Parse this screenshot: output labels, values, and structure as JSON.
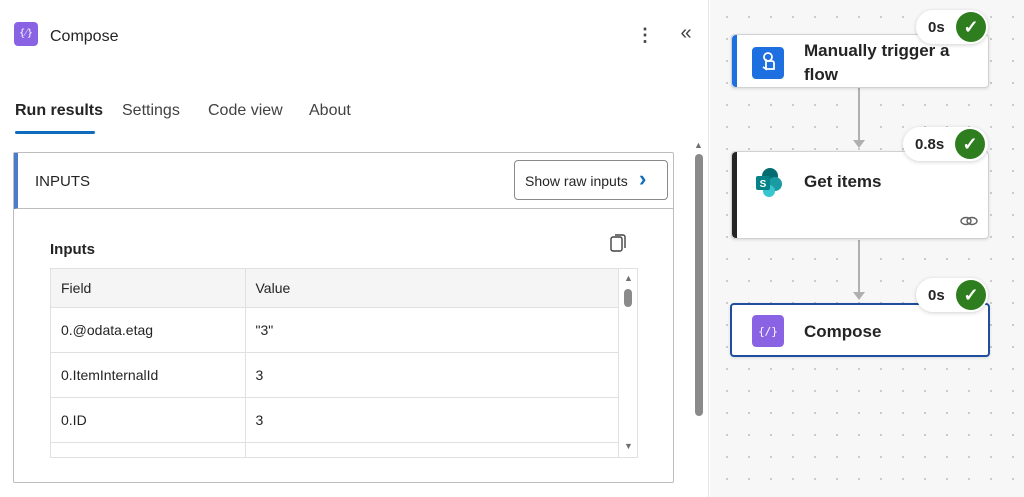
{
  "panel": {
    "title": "Compose",
    "icon": "compose-icon",
    "more_icon": "more-vertical-icon",
    "more_glyph": "⋮",
    "collapse_icon": "double-chevron-left-icon",
    "collapse_glyph": "«",
    "compose_glyph": "{⁄}",
    "tabs": [
      {
        "label": "Run results",
        "active": true
      },
      {
        "label": "Settings",
        "active": false
      },
      {
        "label": "Code view",
        "active": false
      },
      {
        "label": "About",
        "active": false
      }
    ],
    "inputs_section": {
      "header": "INPUTS",
      "show_raw_label": "Show raw inputs",
      "chevron_glyph": "›",
      "label": "Inputs",
      "copy_icon": "copy-icon",
      "columns": [
        "Field",
        "Value"
      ],
      "rows": [
        {
          "field": "0.@odata.etag",
          "value": "\"3\""
        },
        {
          "field": "0.ItemInternalId",
          "value": "3"
        },
        {
          "field": "0.ID",
          "value": "3"
        }
      ]
    }
  },
  "canvas": {
    "nodes": [
      {
        "label": "Manually trigger a flow",
        "duration": "0s",
        "status": "succeeded",
        "icon": "manual-trigger-icon"
      },
      {
        "label": "Get items",
        "duration": "0.8s",
        "status": "succeeded",
        "icon": "sharepoint-icon",
        "link_icon": "link-icon"
      },
      {
        "label": "Compose",
        "duration": "0s",
        "status": "succeeded",
        "icon": "compose-icon",
        "selected": true
      }
    ],
    "check_glyph": "✓"
  },
  "colors": {
    "accent": "#0f6cbd",
    "compose_purple": "#8a63e4",
    "trigger_blue": "#1e6fe0",
    "sharepoint_teal": "#038387",
    "success_green": "#2e7d1e"
  }
}
